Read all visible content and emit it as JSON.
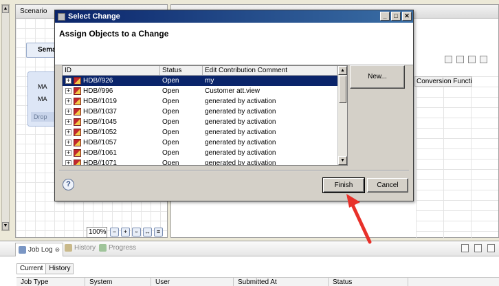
{
  "background": {
    "scenario_title": "Scenario",
    "semantics_label": "Sema",
    "node_rows": [
      "MA",
      "MA"
    ],
    "node_drop": "Drop",
    "zoom_level": "100%",
    "right_column_header": "Conversion Functions"
  },
  "dialog": {
    "title": "Select Change",
    "heading": "Assign Objects to a Change",
    "table": {
      "columns": [
        "ID",
        "Status",
        "Edit Contribution Comment"
      ],
      "rows": [
        {
          "id": "HDB//926",
          "status": "Open",
          "comment": "my",
          "selected": true
        },
        {
          "id": "HDB//996",
          "status": "Open",
          "comment": "Customer att.view",
          "selected": false
        },
        {
          "id": "HDB//1019",
          "status": "Open",
          "comment": "generated by activation",
          "selected": false
        },
        {
          "id": "HDB//1037",
          "status": "Open",
          "comment": "generated by activation",
          "selected": false
        },
        {
          "id": "HDB//1045",
          "status": "Open",
          "comment": "generated by activation",
          "selected": false
        },
        {
          "id": "HDB//1052",
          "status": "Open",
          "comment": "generated by activation",
          "selected": false
        },
        {
          "id": "HDB//1057",
          "status": "Open",
          "comment": "generated by activation",
          "selected": false
        },
        {
          "id": "HDB//1061",
          "status": "Open",
          "comment": "generated by activation",
          "selected": false
        },
        {
          "id": "HDB//1071",
          "status": "Open",
          "comment": "generated by activation",
          "selected": false
        }
      ]
    },
    "new_button": "New...",
    "help_glyph": "?",
    "finish_button": "Finish",
    "cancel_button": "Cancel"
  },
  "joblog": {
    "tabs": [
      "Job Log",
      "History",
      "Progress"
    ],
    "subtabs": [
      "Current",
      "History"
    ],
    "columns": [
      "Job Type",
      "System",
      "User",
      "Submitted At",
      "Status"
    ]
  },
  "colors": {
    "selection": "#0a246a",
    "arrow": "#e8312a"
  }
}
